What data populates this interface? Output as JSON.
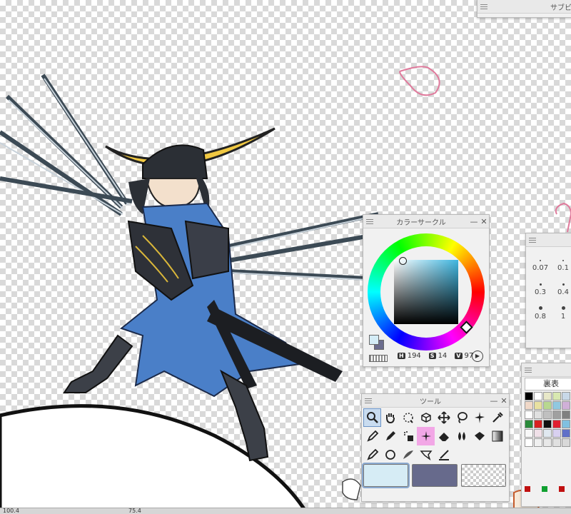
{
  "app": {
    "subview_title": "サブビ",
    "colors": {
      "accent": "#6a93c6",
      "panel_bg": "#f1f1f1",
      "main_color": "#d4ecf6",
      "sub_color": "#6c6d8e"
    }
  },
  "color_circle": {
    "title": "カラーサークル",
    "h_label": "H",
    "h_value": "194",
    "s_label": "S",
    "s_value": "14",
    "v_label": "V",
    "v_value": "97"
  },
  "tool_panel": {
    "title": "ツール",
    "tools": [
      "zoom-tool",
      "hand-tool",
      "lasso-select-tool",
      "object-tool",
      "move-tool",
      "selection-tool",
      "auto-select-tool",
      "eyedropper-tool",
      "pen-tool",
      "marker-tool",
      "airbrush-tool",
      "sparkle-tool",
      "eraser-tool",
      "blend-tool",
      "fill-tool",
      "gradient-tool",
      "pen2-tool",
      "figure-tool",
      "frame-tool",
      "balloon-tool",
      "ruler-tool"
    ]
  },
  "brush_size": {
    "values": [
      "0.07",
      "0.1",
      "0.3",
      "0.4",
      "0.8",
      "1"
    ]
  },
  "color_set": {
    "label": "裏表"
  },
  "status_bar": {
    "zoom": "100.4",
    "angle": "75.4"
  }
}
